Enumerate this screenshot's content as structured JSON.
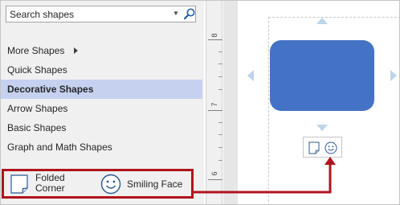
{
  "search": {
    "value": "Search shapes",
    "placeholder": "Search shapes"
  },
  "menu": {
    "items": [
      {
        "label": "More Shapes"
      },
      {
        "label": "Quick Shapes"
      },
      {
        "label": "Decorative Shapes"
      },
      {
        "label": "Arrow Shapes"
      },
      {
        "label": "Basic Shapes"
      },
      {
        "label": "Graph and Math Shapes"
      }
    ]
  },
  "stencil": {
    "items": [
      {
        "label": "Folded\nCorner",
        "icon": "folded-corner-icon"
      },
      {
        "label": "Smiling Face",
        "icon": "smiling-face-icon"
      }
    ]
  },
  "ruler": {
    "labels": [
      "8",
      "7",
      "6"
    ]
  },
  "colors": {
    "shape_fill": "#4472c4",
    "selection_bg": "#c5d1ef",
    "highlight": "#b0141d",
    "autoconnect_arrow": "#bcd4ea"
  }
}
